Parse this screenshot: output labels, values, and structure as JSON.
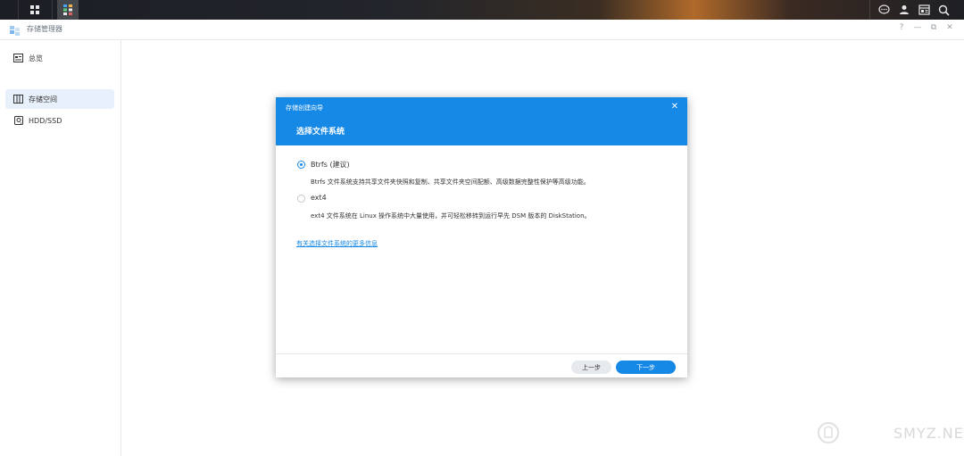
{
  "app": {
    "title": "存储管理器",
    "window_controls": [
      "?",
      "—",
      "⧉",
      "✕"
    ]
  },
  "taskbar": {
    "left_icons": [
      "main-menu-icon",
      "storage-manager-icon"
    ],
    "right_icons": [
      "chat-icon",
      "user-icon",
      "widgets-icon",
      "search-icon"
    ]
  },
  "sidebar": {
    "items": [
      {
        "label": "总览",
        "icon": "overview-icon",
        "selected": false
      },
      {
        "label": "存储空间",
        "icon": "storage-icon",
        "selected": true
      },
      {
        "label": "HDD/SSD",
        "icon": "drive-icon",
        "selected": false
      }
    ]
  },
  "dialog": {
    "title": "存储创建向导",
    "subtitle": "选择文件系统",
    "options": [
      {
        "label": "Btrfs (建议)",
        "description": "Btrfs 文件系统支持共享文件夹快照和复制、共享文件夹空间配额、高级数据完整性保护等高级功能。",
        "selected": true
      },
      {
        "label": "ext4",
        "description": "ext4 文件系统在 Linux 操作系统中大量使用，并可轻松移转到运行早先 DSM 版本的 DiskStation。",
        "selected": false
      }
    ],
    "more_info_link": "有关选择文件系统的更多信息",
    "prev_button": "上一步",
    "next_button": "下一步"
  },
  "watermark": {
    "text": "SMYZ.NET"
  },
  "colors": {
    "accent": "#1688e6",
    "sidebar_selected": "#e8f1fb"
  }
}
